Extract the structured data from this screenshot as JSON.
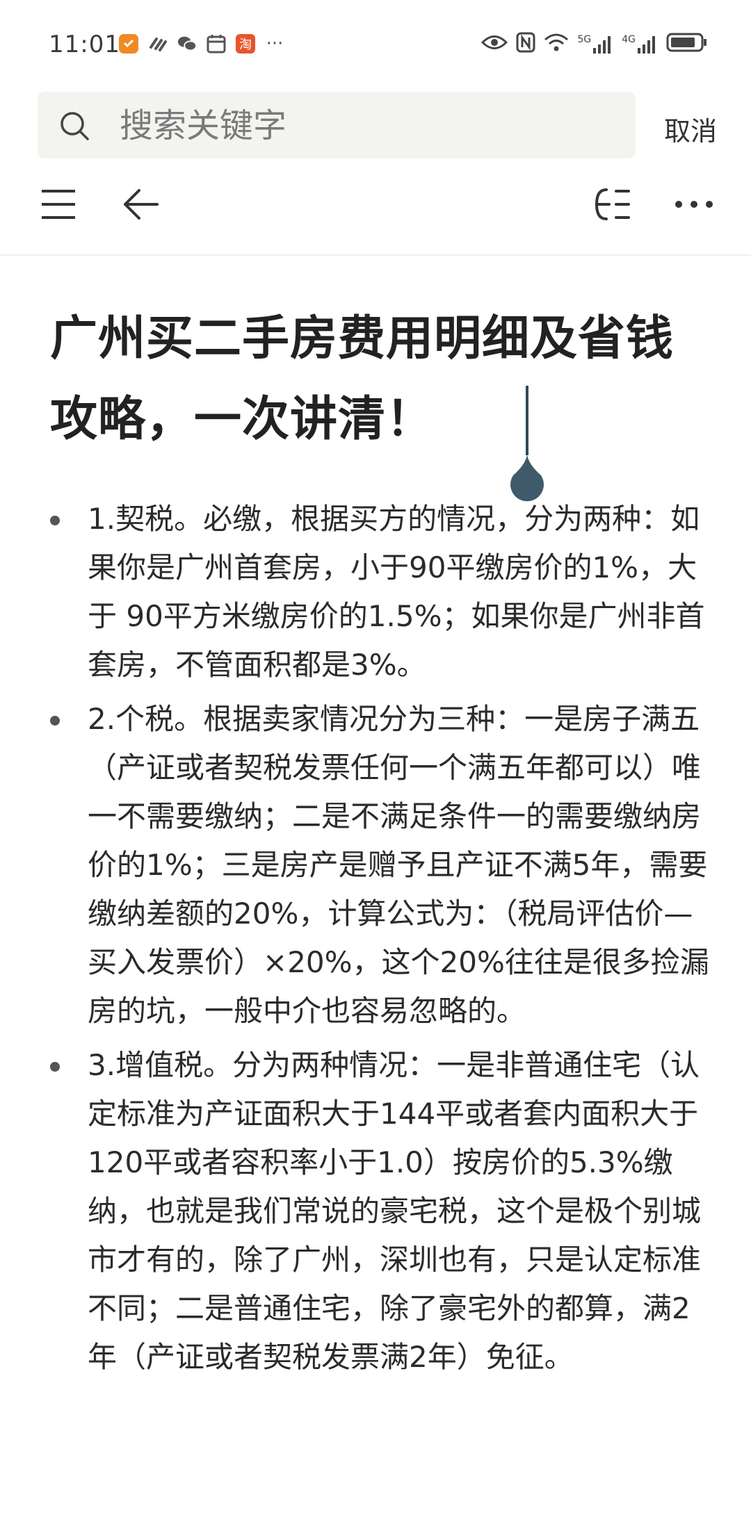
{
  "status_bar": {
    "time": "11:01",
    "left_icons": [
      "shield-app-icon",
      "link-icon",
      "wechat-icon",
      "calendar-icon",
      "taobao-icon",
      "more-dots-icon"
    ],
    "more_text": "···",
    "right_icons": [
      "eye-icon",
      "nfc-icon",
      "wifi-icon",
      "signal-5g-icon",
      "signal-4g-icon",
      "battery-icon"
    ],
    "signal_1_label": "5G",
    "signal_2_label": "4G"
  },
  "search": {
    "placeholder": "搜索关键字",
    "value": "",
    "cancel_label": "取消"
  },
  "toolbar": {
    "icons": [
      "menu-icon",
      "back-arrow-icon",
      "outline-icon",
      "more-icon"
    ]
  },
  "article": {
    "title": "广州买二手房费用明细及省钱攻略，一次讲清！",
    "items": [
      {
        "text": "1.契税。必缴，根据买方的情况，分为两种：如果你是广州首套房，小于90平缴房价的1%，大于 90平方米缴房价的1.5%；如果你是广州非首套房，不管面积都是3%。"
      },
      {
        "text": "2.个税。根据卖家情况分为三种：一是房子满五（产证或者契税发票任何一个满五年都可以）唯一不需要缴纳；二是不满足条件一的需要缴纳房价的1%；三是房产是赠予且产证不满5年，需要缴纳差额的20%，计算公式为：（税局评估价—买入发票价）×20%，这个20%往往是很多捡漏房的坑，一般中介也容易忽略的。"
      },
      {
        "text": "3.增值税。分为两种情况：一是非普通住宅（认定标准为产证面积大于144平或者套内面积大于120平或者容积率小于1.0）按房价的5.3%缴纳，也就是我们常说的豪宅税，这个是极个别城市才有的，除了广州，深圳也有，只是认定标准不同；二是普通住宅，除了豪宅外的都算，满2年（产证或者契税发票满2年）免征。"
      }
    ]
  },
  "colors": {
    "cursor": "#2f4a58",
    "search_bg": "#f3f3f0",
    "text": "#2b2b2b"
  }
}
